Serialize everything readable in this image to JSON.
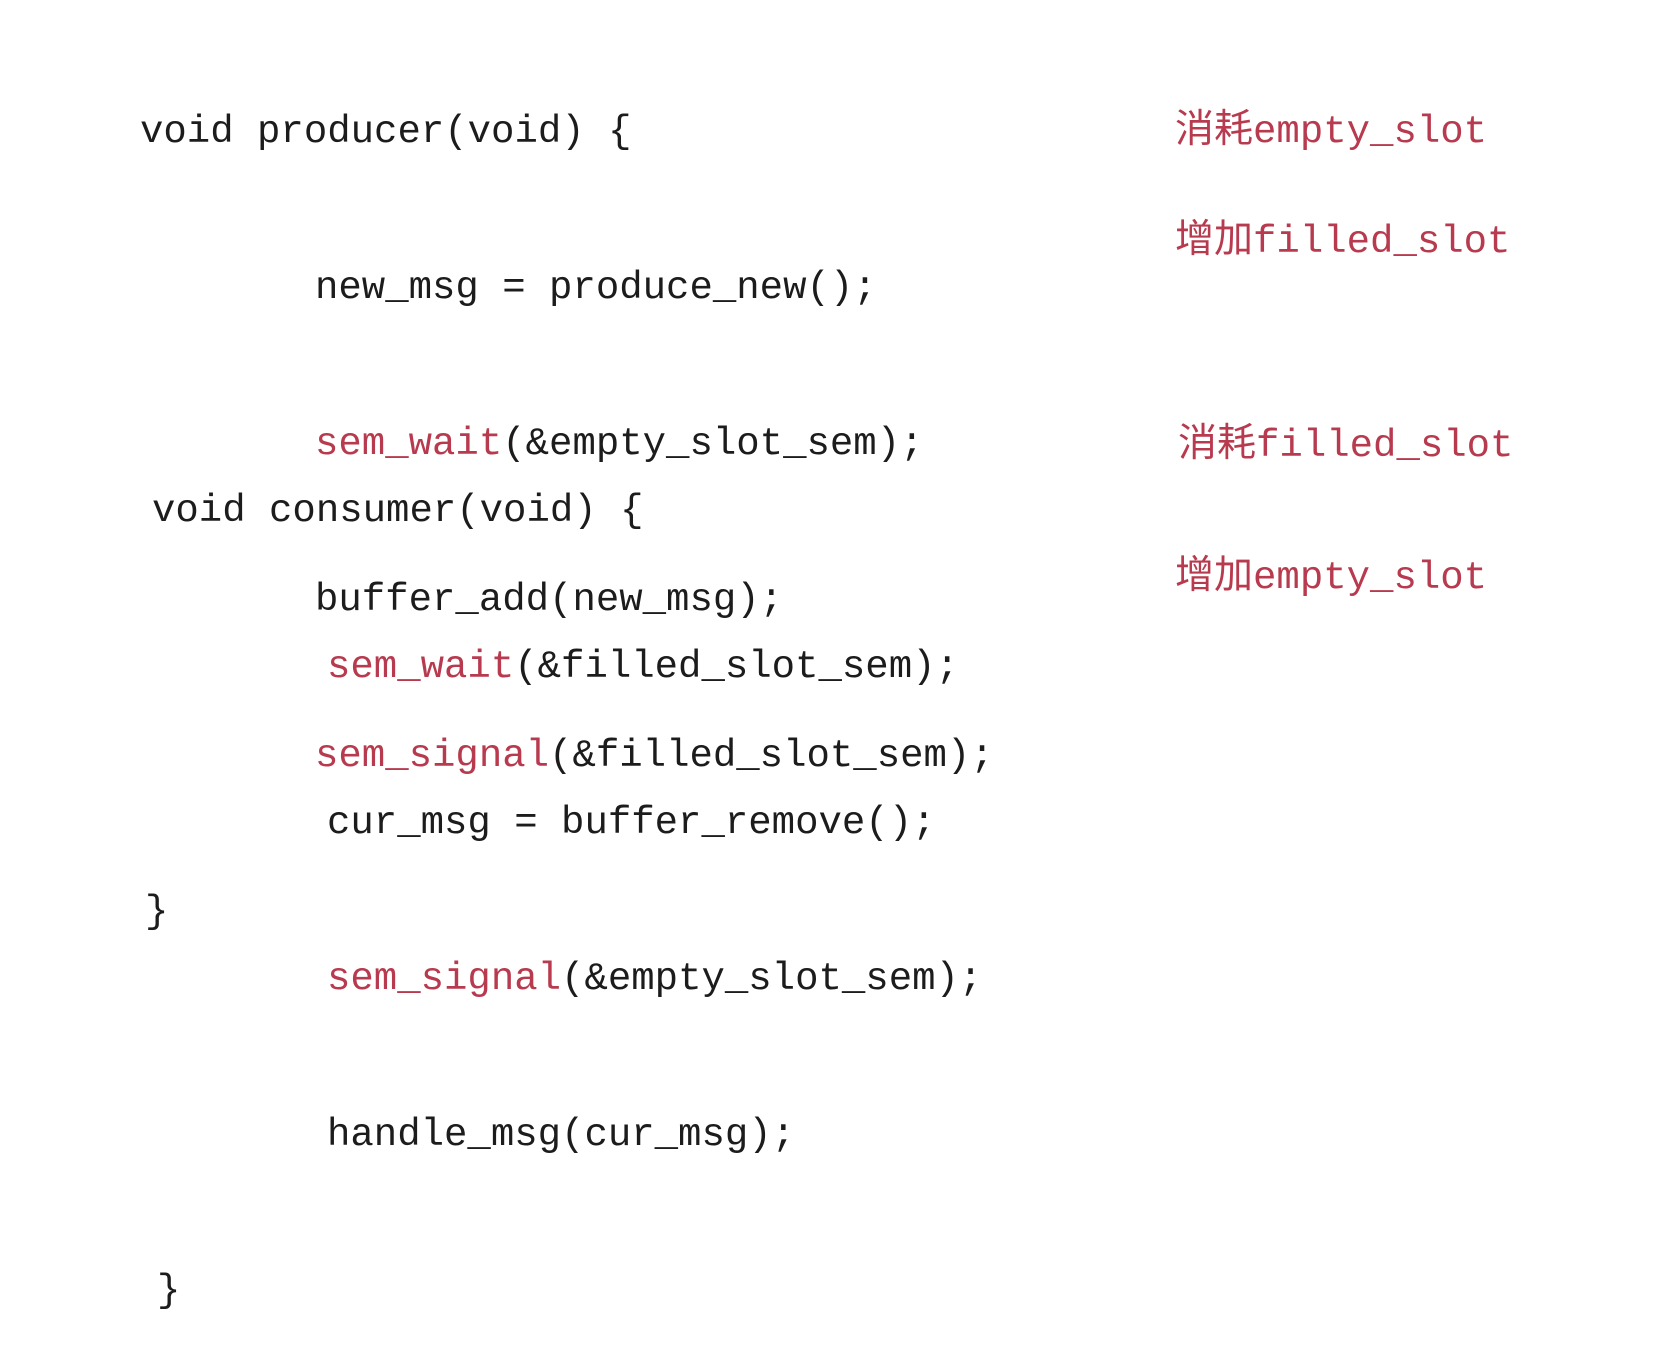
{
  "colors": {
    "text": "#1c1c1c",
    "accent": "#b83a4e",
    "background": "#ffffff"
  },
  "producer": {
    "header": "void producer(void) {",
    "line1": "new_msg = produce_new();",
    "line2_fn": "sem_wait",
    "line2_args": "(&empty_slot_sem);",
    "line3": "buffer_add(new_msg);",
    "line4_fn": "sem_signal",
    "line4_args": "(&filled_slot_sem);",
    "close": "}"
  },
  "consumer": {
    "header": "void consumer(void) {",
    "line1_fn": "sem_wait",
    "line1_args": "(&filled_slot_sem);",
    "line2": "cur_msg = buffer_remove();",
    "line3_fn": "sem_signal",
    "line3_args": "(&empty_slot_sem);",
    "line4": "handle_msg(cur_msg);",
    "close": "}"
  },
  "annotations": {
    "a1_cjk": "消耗",
    "a1_code": "empty_slot",
    "a2_cjk": "增加",
    "a2_code": "filled_slot",
    "a3_cjk": "消耗",
    "a3_code": "filled_slot",
    "a4_cjk": "增加",
    "a4_code": "empty_slot"
  }
}
